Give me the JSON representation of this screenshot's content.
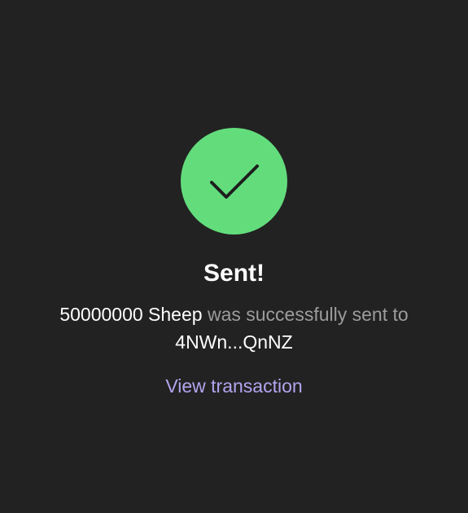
{
  "status": {
    "icon": "checkmark-icon",
    "color": "#63dd7c"
  },
  "title": "Sent!",
  "message": {
    "amount": "50000000 Sheep",
    "text_middle": " was successfully sent to ",
    "recipient": "4NWn...QnNZ"
  },
  "link": {
    "label": "View transaction",
    "color": "#b3a4ee"
  }
}
